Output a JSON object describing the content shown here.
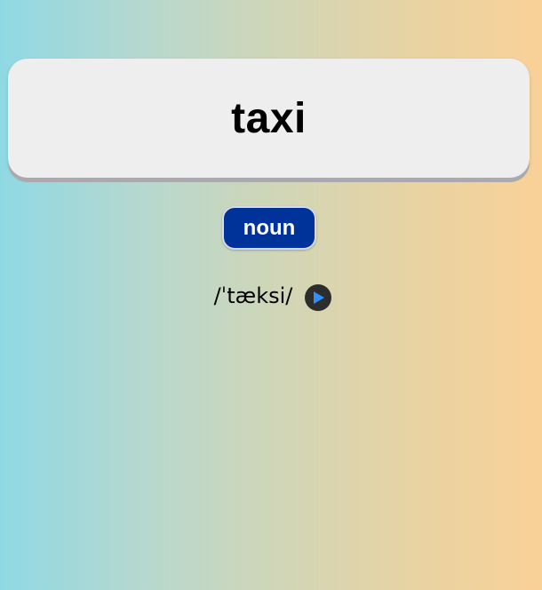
{
  "word": {
    "text": "taxi"
  },
  "part_of_speech": {
    "label": "noun"
  },
  "pronunciation": {
    "phonetic": "/ˈtæksi/",
    "play_icon": "play-icon"
  },
  "colors": {
    "card_background": "#eeeeee",
    "badge_background": "#00339a",
    "play_button_background": "#2d2d2d",
    "play_triangle": "#2f8fff",
    "gradient_left": "#8fd9e4",
    "gradient_right": "#f9d197"
  }
}
